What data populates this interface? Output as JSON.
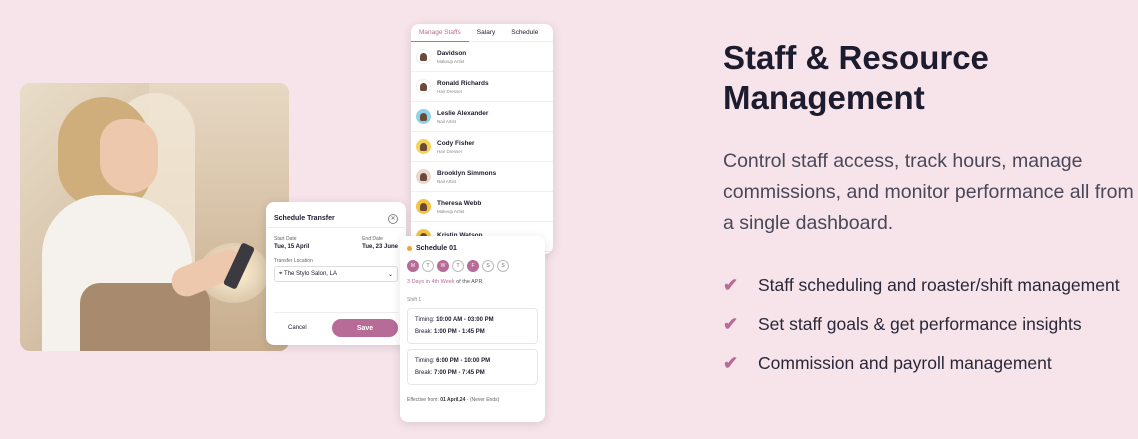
{
  "heading": "Staff & Resource Management",
  "description": "Control staff access, track hours, manage commissions, and monitor performance all from a single dashboard.",
  "features": [
    "Staff scheduling and roaster/shift management",
    "Set staff goals & get performance insights",
    "Commission and payroll management"
  ],
  "accent_color": "#b76b97",
  "transfer": {
    "title": "Schedule Transfer",
    "start_label": "Start Date",
    "start_value": "Tue, 15 April",
    "end_label": "End Date",
    "end_value": "Tue, 23 June",
    "location_label": "Transfer Location",
    "location_value": "The Stylo Salon, LA",
    "cancel": "Cancel",
    "save": "Save"
  },
  "staff": {
    "tabs": [
      "Manage Staffs",
      "Salary",
      "Schedule"
    ],
    "members": [
      {
        "name": "Davidson",
        "role": "Makeup Artist",
        "avatar_bg": "#ffffff"
      },
      {
        "name": "Ronald Richards",
        "role": "Hair Dresser",
        "avatar_bg": "#ffffff"
      },
      {
        "name": "Leslie Alexander",
        "role": "Nail Artist",
        "avatar_bg": "#8fd3e8"
      },
      {
        "name": "Cody Fisher",
        "role": "Hair Dresser",
        "avatar_bg": "#f5d35a"
      },
      {
        "name": "Brooklyn Simmons",
        "role": "Nail Artist",
        "avatar_bg": "#e8d8cf"
      },
      {
        "name": "Theresa Webb",
        "role": "Makeup Artist",
        "avatar_bg": "#f5c542"
      },
      {
        "name": "Kristin Watson",
        "role": "",
        "avatar_bg": "#f5c542"
      }
    ]
  },
  "schedule": {
    "title": "Schedule 01",
    "days": [
      {
        "d": "M",
        "on": true
      },
      {
        "d": "T",
        "on": false
      },
      {
        "d": "W",
        "on": true
      },
      {
        "d": "T",
        "on": false
      },
      {
        "d": "F",
        "on": true
      },
      {
        "d": "S",
        "on": false
      },
      {
        "d": "S",
        "on": false
      }
    ],
    "week_highlight": "3 Days in 4th Week",
    "week_suffix": " of the APR",
    "shift_label": "Shift 1",
    "shifts": [
      {
        "timing_label": "Timing: ",
        "timing": "10:00 AM - 03:00 PM",
        "break_label": "Break: ",
        "break": "1:00 PM - 1:45 PM"
      },
      {
        "timing_label": "Timing: ",
        "timing": "6:00 PM - 10:00 PM",
        "break_label": "Break: ",
        "break": "7:00 PM - 7:45 PM"
      }
    ],
    "effective_label": "Effective from: ",
    "effective_value": "01 April,24",
    "effective_suffix": " - (Never Ends)"
  }
}
